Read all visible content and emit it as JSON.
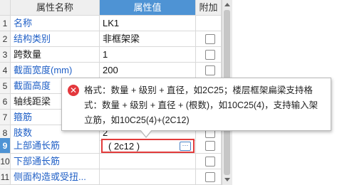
{
  "table": {
    "headers": {
      "name": "属性名称",
      "value": "属性值",
      "add": "附加"
    },
    "rows": [
      {
        "num": "1",
        "name": "名称",
        "value": "LK1",
        "name_color": "blue",
        "checkbox": false
      },
      {
        "num": "2",
        "name": "结构类别",
        "value": "非框架梁",
        "name_color": "blue",
        "checkbox": true
      },
      {
        "num": "3",
        "name": "跨数量",
        "value": "1",
        "name_color": "black",
        "checkbox": true
      },
      {
        "num": "4",
        "name": "截面宽度(mm)",
        "value": "200",
        "name_color": "blue",
        "checkbox": true
      },
      {
        "num": "5",
        "name": "截面高度",
        "value": "",
        "name_color": "blue",
        "checkbox": true
      },
      {
        "num": "6",
        "name": "轴线距梁",
        "value": "",
        "name_color": "black",
        "checkbox": true
      },
      {
        "num": "7",
        "name": "箍筋",
        "value": "",
        "name_color": "blue",
        "checkbox": true
      },
      {
        "num": "8",
        "name": "肢数",
        "value": "2",
        "name_color": "blue",
        "checkbox": true
      },
      {
        "num": "9",
        "name": "上部通长筋",
        "value": "",
        "name_color": "blue",
        "checkbox": true
      },
      {
        "num": "10",
        "name": "下部通长筋",
        "value": "",
        "name_color": "blue",
        "checkbox": true
      },
      {
        "num": "11",
        "name": "侧面构造或受扭...",
        "value": "",
        "name_color": "blue",
        "checkbox": true
      }
    ]
  },
  "editor": {
    "value": "( 2c12 )",
    "ellipsis": "···"
  },
  "tooltip": {
    "icon": "error-icon",
    "symbol": "✕",
    "text": "格式：数量 + 级别 + 直径，如2C25；楼层框架扁梁支持格式：数量 + 级别 + 直径 + (根数)，如10C25(4)，支持输入架立筋，如10C25(4)+(2C12)"
  },
  "colors": {
    "accent": "#4e93d4",
    "label_blue": "#1f5fc6",
    "error": "#e23b3b"
  }
}
